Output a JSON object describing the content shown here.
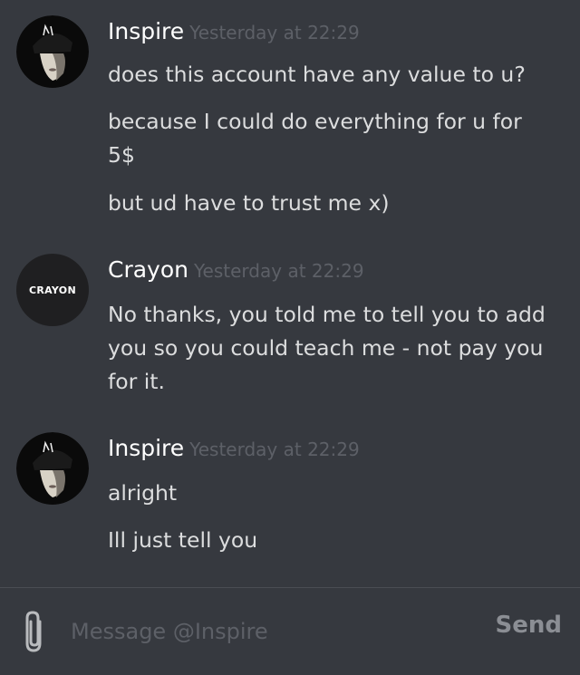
{
  "conversation": {
    "messages": [
      {
        "author": "Inspire",
        "timestamp": "Yesterday at 22:29",
        "avatar": "inspire-avatar",
        "lines": [
          "does this account have any value to u?",
          "because I could do everything for u for 5$",
          "but ud have to trust me x)"
        ]
      },
      {
        "author": "Crayon",
        "timestamp": "Yesterday at 22:29",
        "avatar_text": "CRAYON",
        "lines": [
          "No thanks, you told me to tell you to add you so you could teach me - not pay you for it."
        ]
      },
      {
        "author": "Inspire",
        "timestamp": "Yesterday at 22:29",
        "avatar": "inspire-avatar",
        "lines": [
          "alright",
          "Ill just tell you"
        ]
      }
    ]
  },
  "composer": {
    "placeholder": "Message @Inspire",
    "send_label": "Send",
    "attach_icon": "paperclip-icon"
  },
  "colors": {
    "background": "#36393f",
    "author": "#ffffff",
    "timestamp": "#5d6067",
    "text": "#dcddde",
    "send": "#8b8e94"
  }
}
